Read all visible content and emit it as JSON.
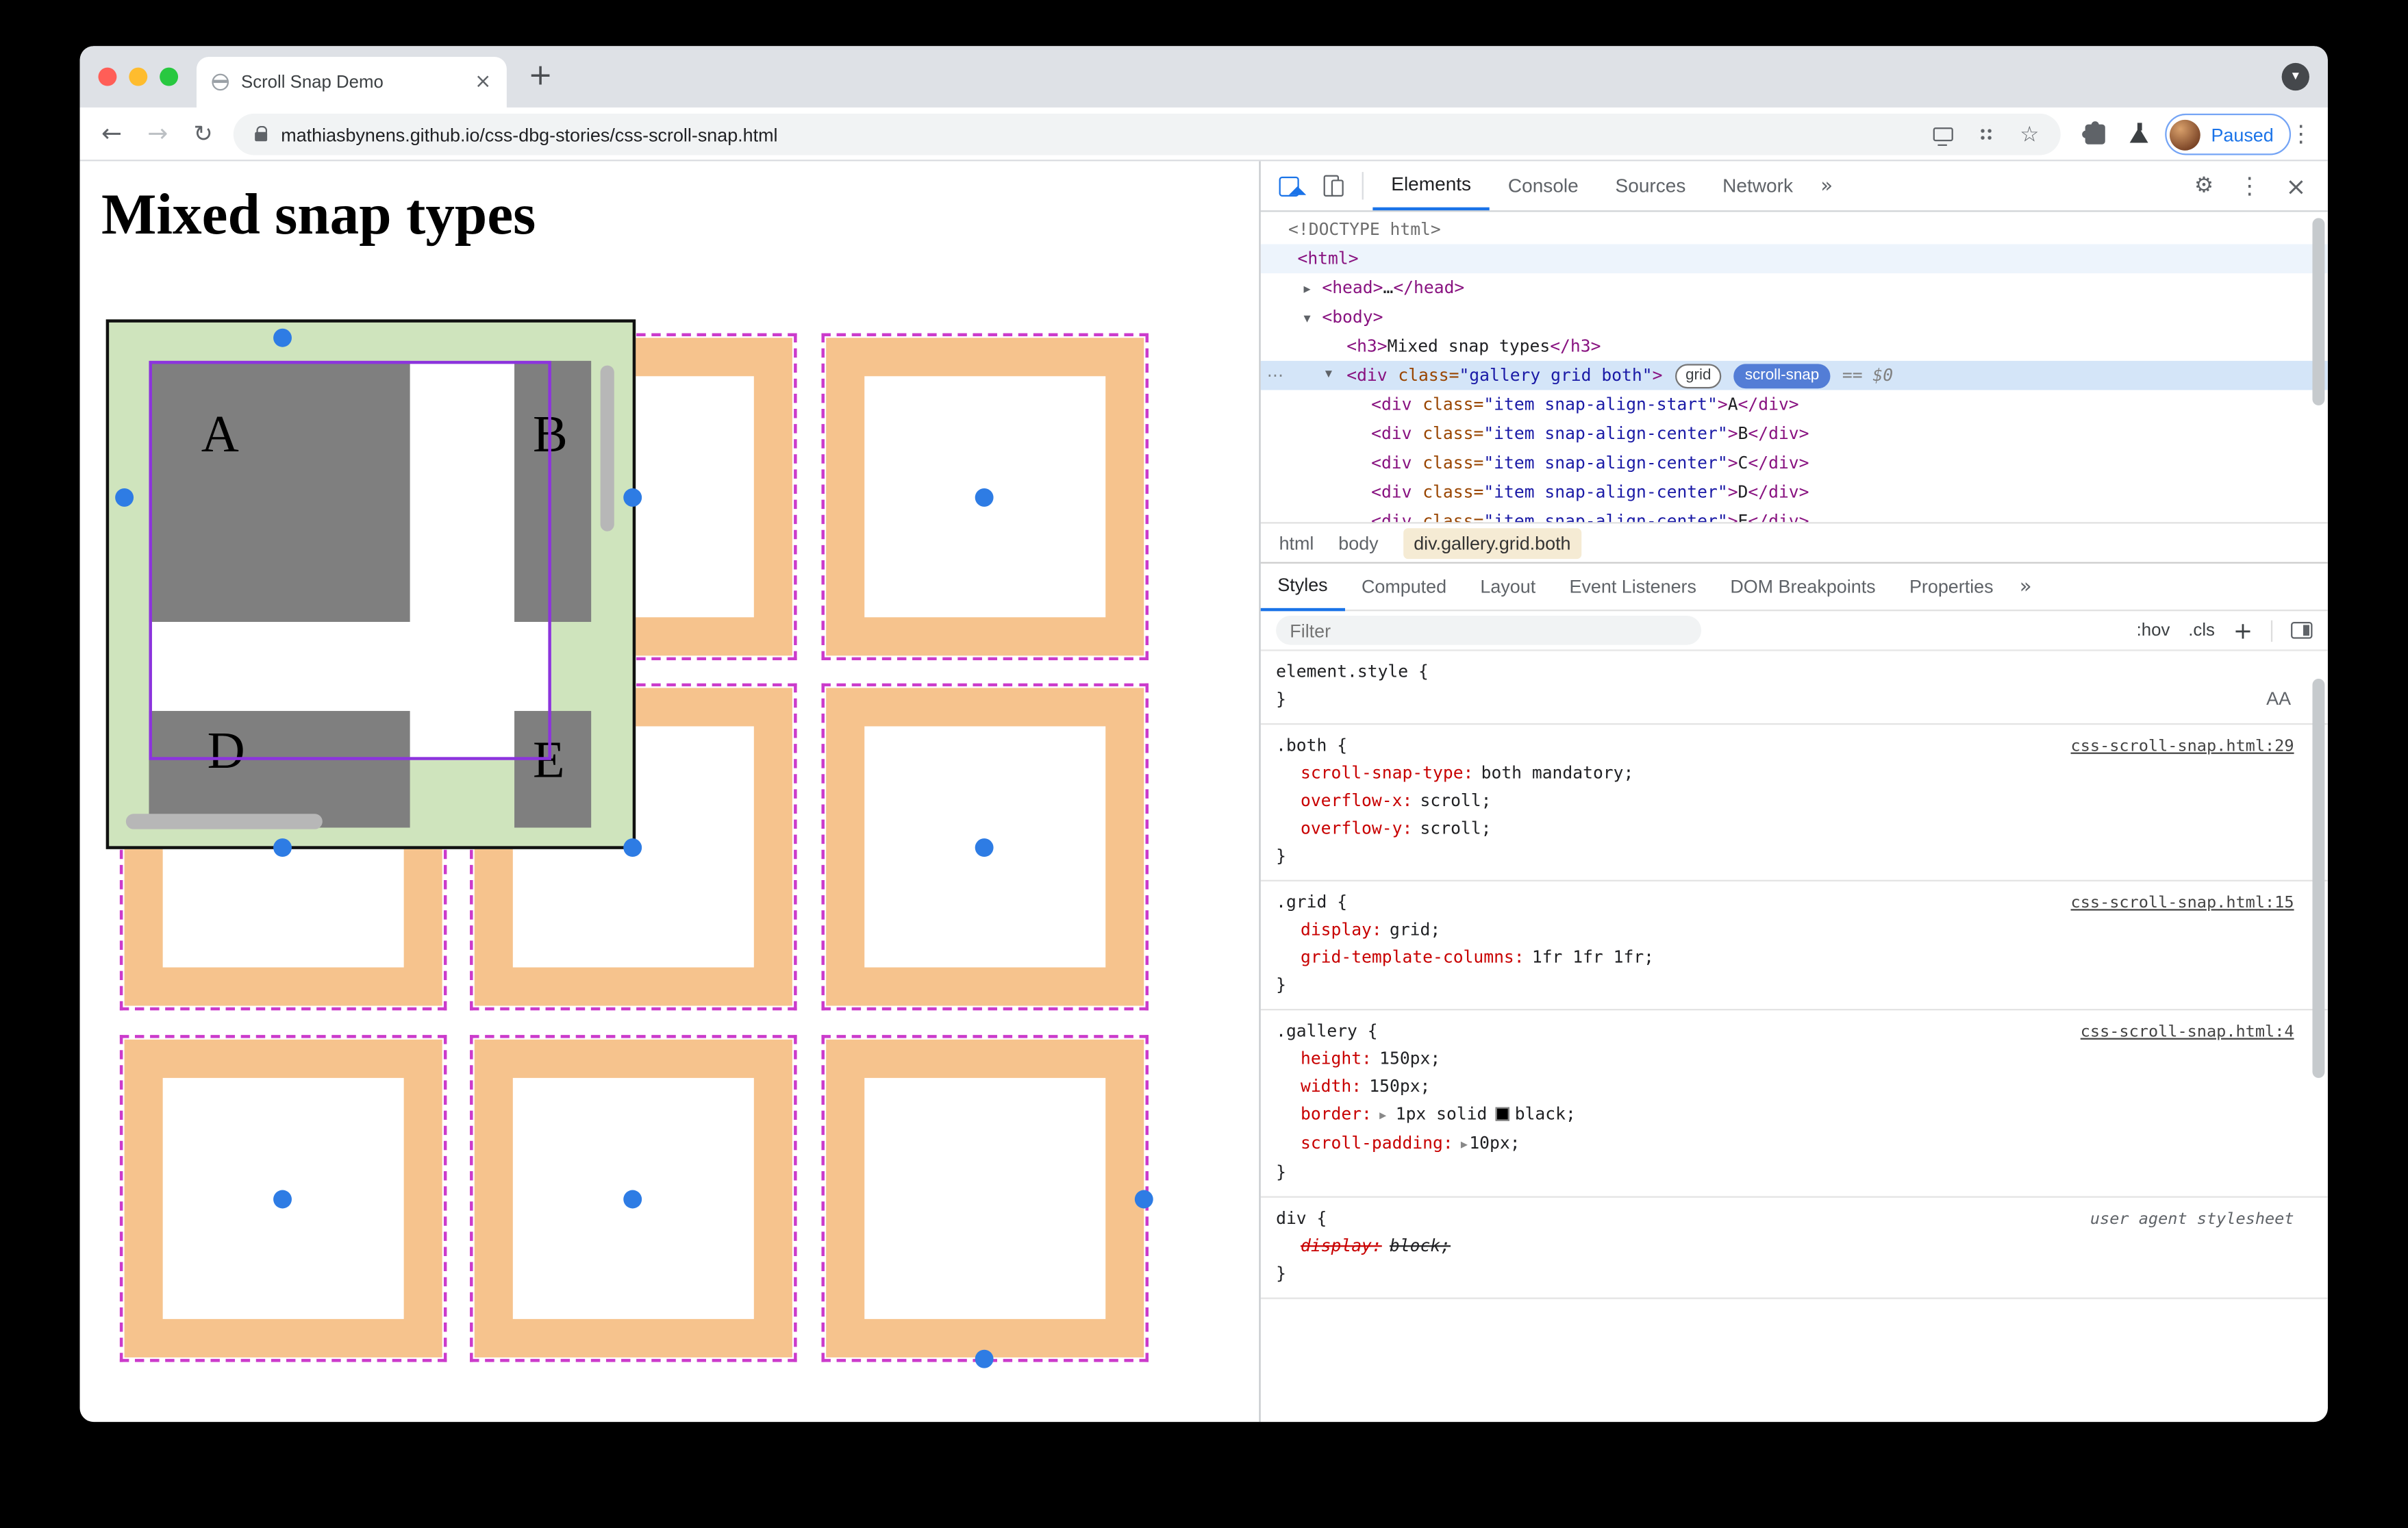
{
  "browser": {
    "tab_title": "Scroll Snap Demo",
    "url": "mathiasbynens.github.io/css-dbg-stories/css-scroll-snap.html",
    "paused_label": "Paused"
  },
  "page": {
    "heading": "Mixed snap types",
    "letters": {
      "a": "A",
      "b": "B",
      "d": "D",
      "e": "E"
    }
  },
  "devtools": {
    "panel_tabs": [
      "Elements",
      "Console",
      "Sources",
      "Network"
    ],
    "dom": {
      "doctype": "<!DOCTYPE html>",
      "html_open": "<html>",
      "head_open": "<head>",
      "head_ellipsis": "…",
      "head_close": "</head>",
      "body_open": "<body>",
      "h3_open": "<h3>",
      "h3_text": "Mixed snap types",
      "h3_close": "</h3>",
      "tok": {
        "div_open": "<div",
        "class_attr": "class=",
        "gt": ">",
        "div_close": "</div>"
      },
      "gallery": {
        "value": "\"gallery grid both\"",
        "badge_grid": "grid",
        "badge_snap": "scroll-snap",
        "dollar": "== $0"
      },
      "items": [
        {
          "value": "\"item snap-align-start\"",
          "text": "A"
        },
        {
          "value": "\"item snap-align-center\"",
          "text": "B"
        },
        {
          "value": "\"item snap-align-center\"",
          "text": "C"
        },
        {
          "value": "\"item snap-align-center\"",
          "text": "D"
        },
        {
          "value": "\"item snap-align-center\"",
          "text": "E"
        }
      ]
    },
    "breadcrumbs": {
      "html": "html",
      "body": "body",
      "selected": "div.gallery.grid.both"
    },
    "sidebar_tabs": [
      "Styles",
      "Computed",
      "Layout",
      "Event Listeners",
      "DOM Breakpoints",
      "Properties"
    ],
    "filter_placeholder": "Filter",
    "toggles": {
      "hov": ":hov",
      "cls": ".cls"
    },
    "styles": {
      "element_style_selector": "element.style {",
      "close_brace": "}",
      "rules": {
        "both": {
          "selector": ".both {",
          "link": "css-scroll-snap.html:29",
          "props": [
            {
              "n": "scroll-snap-type:",
              "v": "both mandatory;"
            },
            {
              "n": "overflow-x:",
              "v": "scroll;"
            },
            {
              "n": "overflow-y:",
              "v": "scroll;"
            }
          ]
        },
        "grid": {
          "selector": ".grid {",
          "link": "css-scroll-snap.html:15",
          "props": [
            {
              "n": "display:",
              "v": "grid;"
            },
            {
              "n": "grid-template-columns:",
              "v": "1fr 1fr 1fr;"
            }
          ]
        },
        "gallery": {
          "selector": ".gallery {",
          "link": "css-scroll-snap.html:4",
          "props": [
            {
              "n": "height:",
              "v": "150px;"
            },
            {
              "n": "width:",
              "v": "150px;"
            },
            {
              "n": "border:",
              "v1": "1px solid",
              "v2": "black;"
            },
            {
              "n": "scroll-padding:",
              "v": "10px;"
            }
          ]
        },
        "div": {
          "selector": "div {",
          "link": "user agent stylesheet",
          "props": [
            {
              "n": "display:",
              "v": "block;"
            }
          ]
        }
      }
    }
  },
  "icons": {
    "back": "←",
    "forward": "→",
    "reload": "↻",
    "star": "☆",
    "menu_kebab": "⋮",
    "close": "×",
    "new_tab": "+",
    "chevron_down": "▾",
    "gear": "⚙",
    "more": "»",
    "tri_right": "▸",
    "tri_down": "▾",
    "row_dots": "⋯",
    "plus": "+",
    "font_editor": "AA"
  },
  "colors": {
    "accent_blue": "#1a73e8",
    "overlay_green": "#cfe4bd",
    "overlay_orange": "#f6c38d",
    "overlay_purple": "#8c34dd",
    "overlay_magenta": "#cb3bcb",
    "snap_dot_blue": "#2e7ce4"
  }
}
